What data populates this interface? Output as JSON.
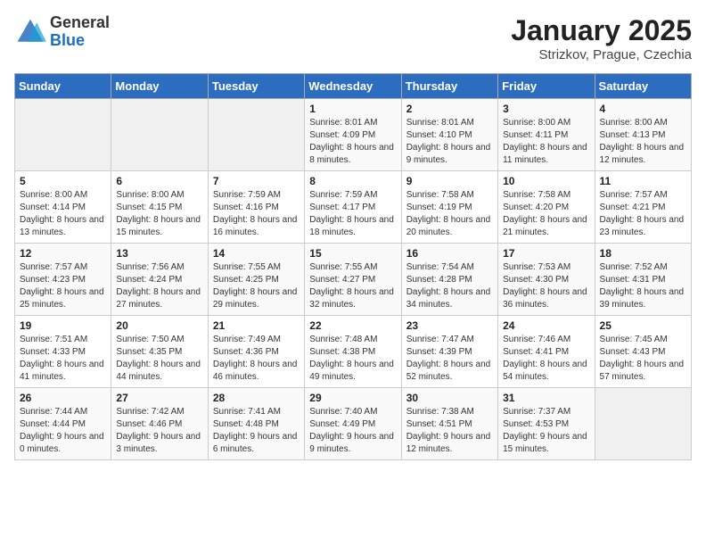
{
  "logo": {
    "general": "General",
    "blue": "Blue"
  },
  "title": "January 2025",
  "subtitle": "Strizkov, Prague, Czechia",
  "days_of_week": [
    "Sunday",
    "Monday",
    "Tuesday",
    "Wednesday",
    "Thursday",
    "Friday",
    "Saturday"
  ],
  "weeks": [
    [
      {
        "day": "",
        "info": ""
      },
      {
        "day": "",
        "info": ""
      },
      {
        "day": "",
        "info": ""
      },
      {
        "day": "1",
        "info": "Sunrise: 8:01 AM\nSunset: 4:09 PM\nDaylight: 8 hours and 8 minutes."
      },
      {
        "day": "2",
        "info": "Sunrise: 8:01 AM\nSunset: 4:10 PM\nDaylight: 8 hours and 9 minutes."
      },
      {
        "day": "3",
        "info": "Sunrise: 8:00 AM\nSunset: 4:11 PM\nDaylight: 8 hours and 11 minutes."
      },
      {
        "day": "4",
        "info": "Sunrise: 8:00 AM\nSunset: 4:13 PM\nDaylight: 8 hours and 12 minutes."
      }
    ],
    [
      {
        "day": "5",
        "info": "Sunrise: 8:00 AM\nSunset: 4:14 PM\nDaylight: 8 hours and 13 minutes."
      },
      {
        "day": "6",
        "info": "Sunrise: 8:00 AM\nSunset: 4:15 PM\nDaylight: 8 hours and 15 minutes."
      },
      {
        "day": "7",
        "info": "Sunrise: 7:59 AM\nSunset: 4:16 PM\nDaylight: 8 hours and 16 minutes."
      },
      {
        "day": "8",
        "info": "Sunrise: 7:59 AM\nSunset: 4:17 PM\nDaylight: 8 hours and 18 minutes."
      },
      {
        "day": "9",
        "info": "Sunrise: 7:58 AM\nSunset: 4:19 PM\nDaylight: 8 hours and 20 minutes."
      },
      {
        "day": "10",
        "info": "Sunrise: 7:58 AM\nSunset: 4:20 PM\nDaylight: 8 hours and 21 minutes."
      },
      {
        "day": "11",
        "info": "Sunrise: 7:57 AM\nSunset: 4:21 PM\nDaylight: 8 hours and 23 minutes."
      }
    ],
    [
      {
        "day": "12",
        "info": "Sunrise: 7:57 AM\nSunset: 4:23 PM\nDaylight: 8 hours and 25 minutes."
      },
      {
        "day": "13",
        "info": "Sunrise: 7:56 AM\nSunset: 4:24 PM\nDaylight: 8 hours and 27 minutes."
      },
      {
        "day": "14",
        "info": "Sunrise: 7:55 AM\nSunset: 4:25 PM\nDaylight: 8 hours and 29 minutes."
      },
      {
        "day": "15",
        "info": "Sunrise: 7:55 AM\nSunset: 4:27 PM\nDaylight: 8 hours and 32 minutes."
      },
      {
        "day": "16",
        "info": "Sunrise: 7:54 AM\nSunset: 4:28 PM\nDaylight: 8 hours and 34 minutes."
      },
      {
        "day": "17",
        "info": "Sunrise: 7:53 AM\nSunset: 4:30 PM\nDaylight: 8 hours and 36 minutes."
      },
      {
        "day": "18",
        "info": "Sunrise: 7:52 AM\nSunset: 4:31 PM\nDaylight: 8 hours and 39 minutes."
      }
    ],
    [
      {
        "day": "19",
        "info": "Sunrise: 7:51 AM\nSunset: 4:33 PM\nDaylight: 8 hours and 41 minutes."
      },
      {
        "day": "20",
        "info": "Sunrise: 7:50 AM\nSunset: 4:35 PM\nDaylight: 8 hours and 44 minutes."
      },
      {
        "day": "21",
        "info": "Sunrise: 7:49 AM\nSunset: 4:36 PM\nDaylight: 8 hours and 46 minutes."
      },
      {
        "day": "22",
        "info": "Sunrise: 7:48 AM\nSunset: 4:38 PM\nDaylight: 8 hours and 49 minutes."
      },
      {
        "day": "23",
        "info": "Sunrise: 7:47 AM\nSunset: 4:39 PM\nDaylight: 8 hours and 52 minutes."
      },
      {
        "day": "24",
        "info": "Sunrise: 7:46 AM\nSunset: 4:41 PM\nDaylight: 8 hours and 54 minutes."
      },
      {
        "day": "25",
        "info": "Sunrise: 7:45 AM\nSunset: 4:43 PM\nDaylight: 8 hours and 57 minutes."
      }
    ],
    [
      {
        "day": "26",
        "info": "Sunrise: 7:44 AM\nSunset: 4:44 PM\nDaylight: 9 hours and 0 minutes."
      },
      {
        "day": "27",
        "info": "Sunrise: 7:42 AM\nSunset: 4:46 PM\nDaylight: 9 hours and 3 minutes."
      },
      {
        "day": "28",
        "info": "Sunrise: 7:41 AM\nSunset: 4:48 PM\nDaylight: 9 hours and 6 minutes."
      },
      {
        "day": "29",
        "info": "Sunrise: 7:40 AM\nSunset: 4:49 PM\nDaylight: 9 hours and 9 minutes."
      },
      {
        "day": "30",
        "info": "Sunrise: 7:38 AM\nSunset: 4:51 PM\nDaylight: 9 hours and 12 minutes."
      },
      {
        "day": "31",
        "info": "Sunrise: 7:37 AM\nSunset: 4:53 PM\nDaylight: 9 hours and 15 minutes."
      },
      {
        "day": "",
        "info": ""
      }
    ]
  ]
}
